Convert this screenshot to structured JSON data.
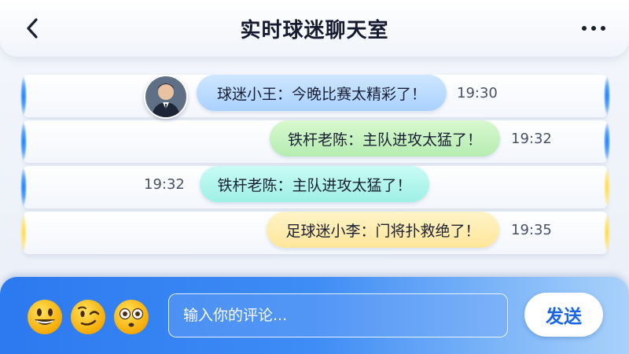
{
  "header": {
    "title": "实时球迷聊天室",
    "back_icon": "chevron-left-icon",
    "more_icon": "more-dots-icon"
  },
  "messages": [
    {
      "text": "球迷小王：今晚比赛太精彩了！",
      "time": "19:30",
      "color": "#a9d1ff",
      "has_avatar": true
    },
    {
      "text": "铁杆老陈：主队进攻太猛了！",
      "time": "19:32",
      "color": "#b5ecb1",
      "has_avatar": false
    },
    {
      "text": "铁杆老陈：主队进攻太猛了！",
      "time": "19:32",
      "color": "#9ff0e6",
      "has_avatar": false
    },
    {
      "text": "足球迷小李：门将扑救绝了！",
      "time": "19:35",
      "color": "#ffe69a",
      "has_avatar": false
    }
  ],
  "composer": {
    "emojis": [
      "grinning-face-icon",
      "winking-face-icon",
      "flushed-face-icon"
    ],
    "placeholder": "输入你的评论...",
    "value": "",
    "send_label": "发送"
  },
  "colors": {
    "accent": "#2c79f0",
    "title_text": "#151a2e"
  }
}
